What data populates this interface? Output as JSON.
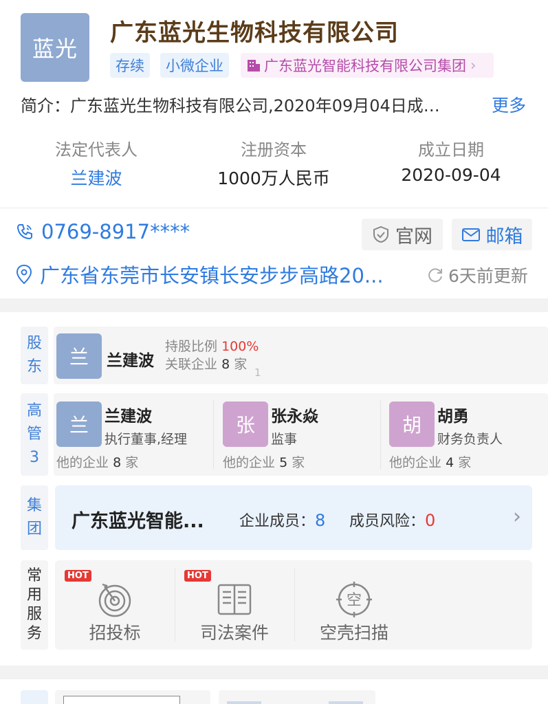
{
  "company": {
    "logo_text": "蓝光",
    "name": "广东蓝光生物科技有限公司",
    "tags": [
      "存续",
      "小微企业"
    ],
    "group_tag": "广东蓝光智能科技有限公司集团",
    "intro": "简介：广东蓝光生物科技有限公司,2020年09月04日成…",
    "more_label": "更多"
  },
  "key_info": [
    {
      "label": "法定代表人",
      "value": "兰建波"
    },
    {
      "label": "注册资本",
      "value": "1000万人民币"
    },
    {
      "label": "成立日期",
      "value": "2020-09-04"
    }
  ],
  "contact": {
    "phone": "0769-8917****",
    "website_label": "官网",
    "email_label": "邮箱",
    "address": "广东省东莞市长安镇长安步步高路20...",
    "updated": "6天前更新"
  },
  "shareholder": {
    "side_label": [
      "股",
      "东"
    ],
    "avatar": "兰",
    "name": "兰建波",
    "ratio_label": "持股比例",
    "ratio_value": "100%",
    "related_label": "关联企业",
    "related_count": "8",
    "related_unit": "家",
    "marker": "1"
  },
  "executives": {
    "side_label": [
      "高",
      "管",
      "3"
    ],
    "items": [
      {
        "avatar": "兰",
        "name": "兰建波",
        "role": "执行董事,经理",
        "other_label": "他的企业",
        "count": "8",
        "unit": "家",
        "color": "#8fa9d1"
      },
      {
        "avatar": "张",
        "name": "张永焱",
        "role": "监事",
        "other_label": "他的企业",
        "count": "5",
        "unit": "家",
        "color": "#cfa3cf"
      },
      {
        "avatar": "胡",
        "name": "胡勇",
        "role": "财务负责人",
        "other_label": "他的企业",
        "count": "4",
        "unit": "家",
        "color": "#cfa3cf"
      }
    ]
  },
  "group": {
    "side_label": [
      "集",
      "团"
    ],
    "name": "广东蓝光智能...",
    "members_label": "企业成员：",
    "members_value": "8",
    "risk_label": "成员风险：",
    "risk_value": "0"
  },
  "services": {
    "side_label": [
      "常",
      "用",
      "服",
      "务"
    ],
    "items": [
      {
        "label": "招投标",
        "badge": "HOT",
        "icon": "target-icon"
      },
      {
        "label": "司法案件",
        "badge": "HOT",
        "icon": "book-icon"
      },
      {
        "label": "空壳扫描",
        "badge": "",
        "icon": "scan-icon"
      }
    ]
  }
}
